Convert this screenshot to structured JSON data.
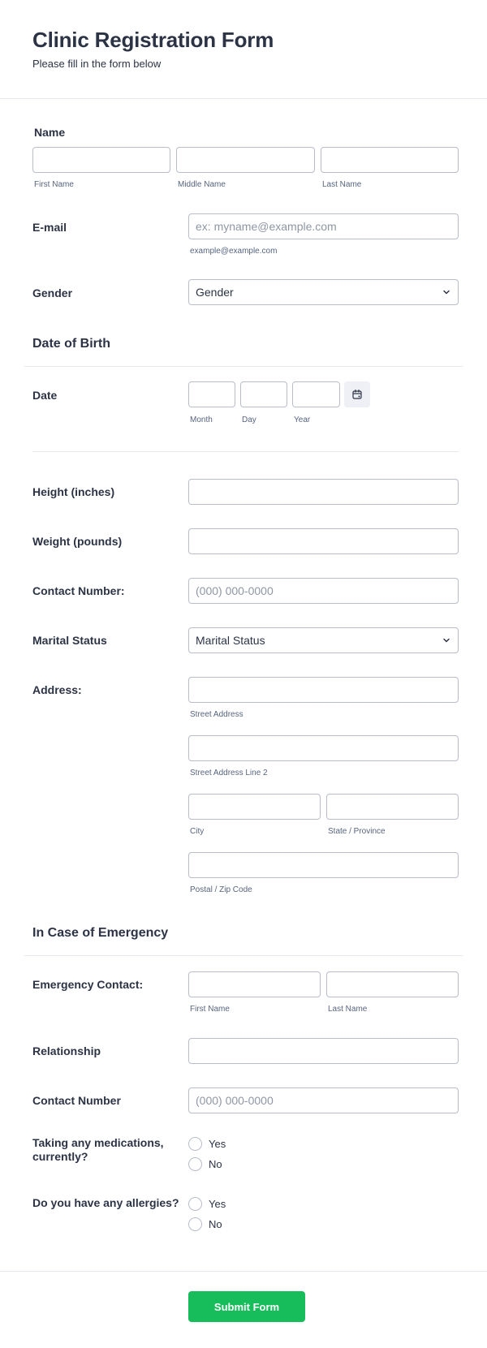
{
  "form": {
    "title": "Clinic Registration Form",
    "subtitle": "Please fill in the form below"
  },
  "name": {
    "label": "Name",
    "first_sublabel": "First Name",
    "middle_sublabel": "Middle Name",
    "last_sublabel": "Last Name"
  },
  "email": {
    "label": "E-mail",
    "placeholder": "ex: myname@example.com",
    "sublabel": "example@example.com"
  },
  "gender": {
    "label": "Gender",
    "selected": "Gender"
  },
  "dob": {
    "section_title": "Date of Birth",
    "label": "Date",
    "month_sublabel": "Month",
    "day_sublabel": "Day",
    "year_sublabel": "Year",
    "calendar_icon": "calendar-icon"
  },
  "height": {
    "label": "Height (inches)"
  },
  "weight": {
    "label": "Weight (pounds)"
  },
  "contact": {
    "label": "Contact Number:",
    "placeholder": "(000) 000-0000"
  },
  "marital": {
    "label": "Marital Status",
    "selected": "Marital Status"
  },
  "address": {
    "label": "Address:",
    "street_sublabel": "Street Address",
    "street2_sublabel": "Street Address Line 2",
    "city_sublabel": "City",
    "state_sublabel": "State / Province",
    "zip_sublabel": "Postal / Zip Code"
  },
  "emergency": {
    "section_title": "In Case of Emergency",
    "contact_label": "Emergency Contact:",
    "first_sublabel": "First Name",
    "last_sublabel": "Last Name",
    "relationship_label": "Relationship",
    "number_label": "Contact Number",
    "number_placeholder": "(000) 000-0000"
  },
  "medications": {
    "label": "Taking any medications, currently?",
    "yes": "Yes",
    "no": "No"
  },
  "allergies": {
    "label": "Do you have any allergies?",
    "yes": "Yes",
    "no": "No"
  },
  "submit": {
    "label": "Submit Form"
  },
  "colors": {
    "accent": "#18bd5b",
    "text": "#2c3345",
    "border": "#b8bdc9"
  }
}
